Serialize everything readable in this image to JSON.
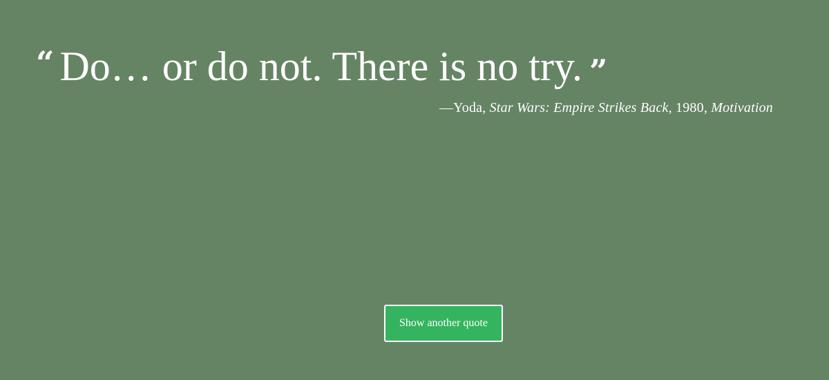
{
  "colors": {
    "background": "#658464",
    "button": "#34b45e",
    "text": "#ffffff"
  },
  "quote": {
    "open_mark": "“",
    "text": "Do… or do not. There is no try.",
    "close_mark": "”"
  },
  "attribution": {
    "dash": "—",
    "author": "Yoda",
    "sep1": ", ",
    "source": "Star Wars: Empire Strikes Back",
    "sep2": ", ",
    "year": "1980",
    "sep3": ", ",
    "category": "Motivation"
  },
  "button": {
    "label": "Show another quote"
  }
}
